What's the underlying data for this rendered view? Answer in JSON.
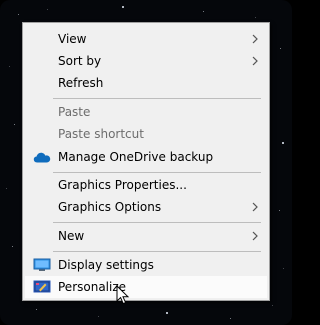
{
  "menu": {
    "view": "View",
    "sort_by": "Sort by",
    "refresh": "Refresh",
    "paste": "Paste",
    "paste_shortcut": "Paste shortcut",
    "manage_onedrive": "Manage OneDrive backup",
    "graphics_properties": "Graphics Properties...",
    "graphics_options": "Graphics Options",
    "new": "New",
    "display_settings": "Display settings",
    "personalize": "Personalize"
  },
  "icons": {
    "onedrive": "cloud-icon",
    "display_settings": "monitor-icon",
    "personalize": "personalize-icon",
    "submenu": "chevron-right-icon",
    "cursor": "mouse-pointer-icon"
  },
  "colors": {
    "desktop_background": "#05070b",
    "menu_background": "#f0f0f0",
    "hover_background": "#fbfbfb",
    "onedrive_blue": "#0f6cbd"
  }
}
